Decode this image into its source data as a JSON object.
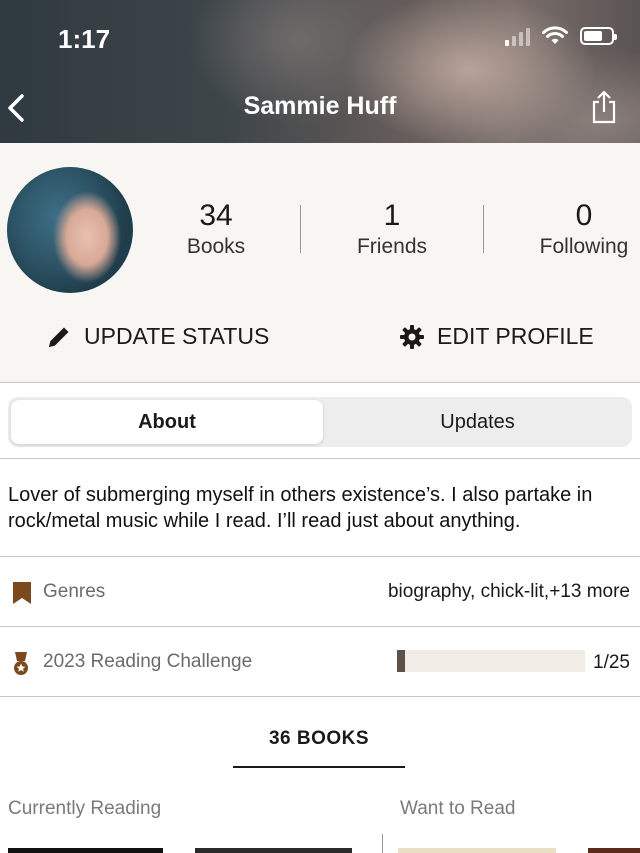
{
  "status_bar": {
    "time": "1:17",
    "icons": [
      "signal-icon",
      "wifi-icon",
      "battery-icon"
    ]
  },
  "header": {
    "title": "Sammie Huff",
    "back_icon": "chevron-left-icon",
    "share_icon": "share-icon"
  },
  "profile": {
    "stats": [
      {
        "value": "34",
        "label": "Books"
      },
      {
        "value": "1",
        "label": "Friends"
      },
      {
        "value": "0",
        "label": "Following"
      }
    ],
    "actions": {
      "update_status": "UPDATE STATUS",
      "edit_profile": "EDIT PROFILE"
    }
  },
  "tabs": [
    {
      "label": "About",
      "active": true
    },
    {
      "label": "Updates",
      "active": false
    }
  ],
  "about": {
    "bio": "Lover of submerging myself in others existence’s. I also partake in rock/metal music while I read. I’ll read just about anything.",
    "genres_label": "Genres",
    "genres_value": "biography, chick-lit,+13 more",
    "challenge_label": "2023 Reading Challenge",
    "challenge_progress": "1/25",
    "challenge_fraction": 0.04
  },
  "books": {
    "tab_label": "36 BOOKS",
    "shelves": [
      "Currently Reading",
      "Want to Read"
    ]
  },
  "colors": {
    "accent_brown": "#7a4a1e",
    "progress_fill": "#5c5248",
    "profile_bg": "#f8f6f2"
  }
}
